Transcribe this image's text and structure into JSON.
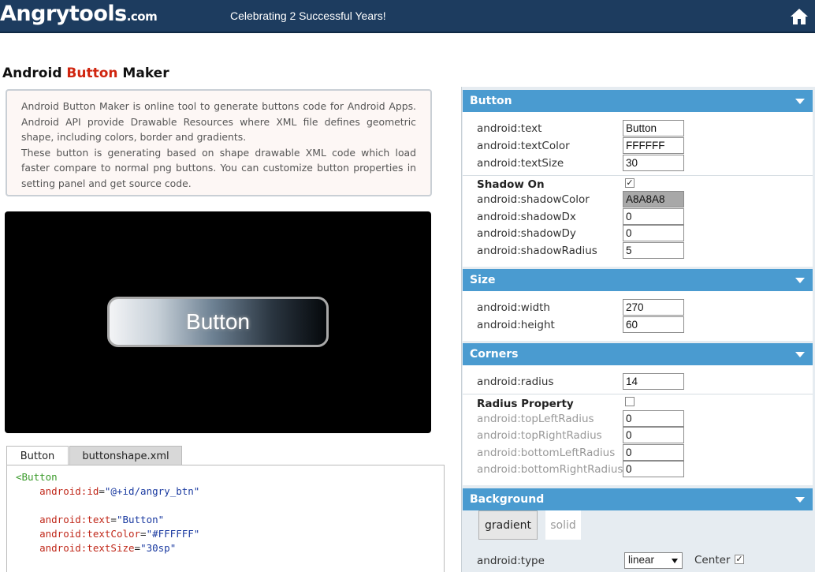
{
  "header": {
    "logo_main": "Angrytools",
    "logo_suffix": ".com",
    "tagline": "Celebrating 2 Successful Years!",
    "home_icon": "home-icon"
  },
  "page": {
    "title_part1": "Android ",
    "title_accent": "Button",
    "title_part2": " Maker",
    "description_1": "Android Button Maker is online tool to generate buttons code for Android Apps. Android API provide Drawable Resources where XML file defines geometric shape, including colors, border and gradients.",
    "description_2": "These button is generating based on shape drawable XML code which load faster compare to normal png buttons. You can customize button properties in setting panel and get source code."
  },
  "preview": {
    "button_text": "Button"
  },
  "tabs": [
    {
      "label": "Button"
    },
    {
      "label": "buttonshape.xml"
    }
  ],
  "code": {
    "tag_open": "<Button",
    "id_attr": "android:id",
    "id_val": "\"@+id/angry_btn\"",
    "text_attr": "android:text",
    "text_val": "\"Button\"",
    "color_attr": "android:textColor",
    "color_val": "\"#FFFFFF\"",
    "size_attr": "android:textSize",
    "size_val": "\"30sp\""
  },
  "panel": {
    "button": {
      "title": "Button",
      "text_label": "android:text",
      "text_value": "Button",
      "text_color_label": "android:textColor",
      "text_color_value": "FFFFFF",
      "text_size_label": "android:textSize",
      "text_size_value": "30",
      "shadow_on": "Shadow On",
      "shadow_color_label": "android:shadowColor",
      "shadow_color_value": "A8A8A8",
      "shadow_dx_label": "android:shadowDx",
      "shadow_dx_value": "0",
      "shadow_dy_label": "android:shadowDy",
      "shadow_dy_value": "0",
      "shadow_radius_label": "android:shadowRadius",
      "shadow_radius_value": "5"
    },
    "size": {
      "title": "Size",
      "width_label": "android:width",
      "width_value": "270",
      "height_label": "android:height",
      "height_value": "60"
    },
    "corners": {
      "title": "Corners",
      "radius_label": "android:radius",
      "radius_value": "14",
      "radius_property": "Radius Property",
      "top_left_label": "android:topLeftRadius",
      "top_left_value": "0",
      "top_right_label": "android:topRightRadius",
      "top_right_value": "0",
      "bottom_left_label": "android:bottomLeftRadius",
      "bottom_left_value": "0",
      "bottom_right_label": "android:bottomRightRadius",
      "bottom_right_value": "0"
    },
    "background": {
      "title": "Background",
      "gradient_label": "gradient",
      "solid_label": "solid",
      "type_label": "android:type",
      "type_value": "linear",
      "center_label": "Center"
    }
  },
  "colors": {
    "header_bg": "#1d3c5f",
    "accent_red": "#d0250f",
    "section_blue": "#4a9bd0"
  }
}
